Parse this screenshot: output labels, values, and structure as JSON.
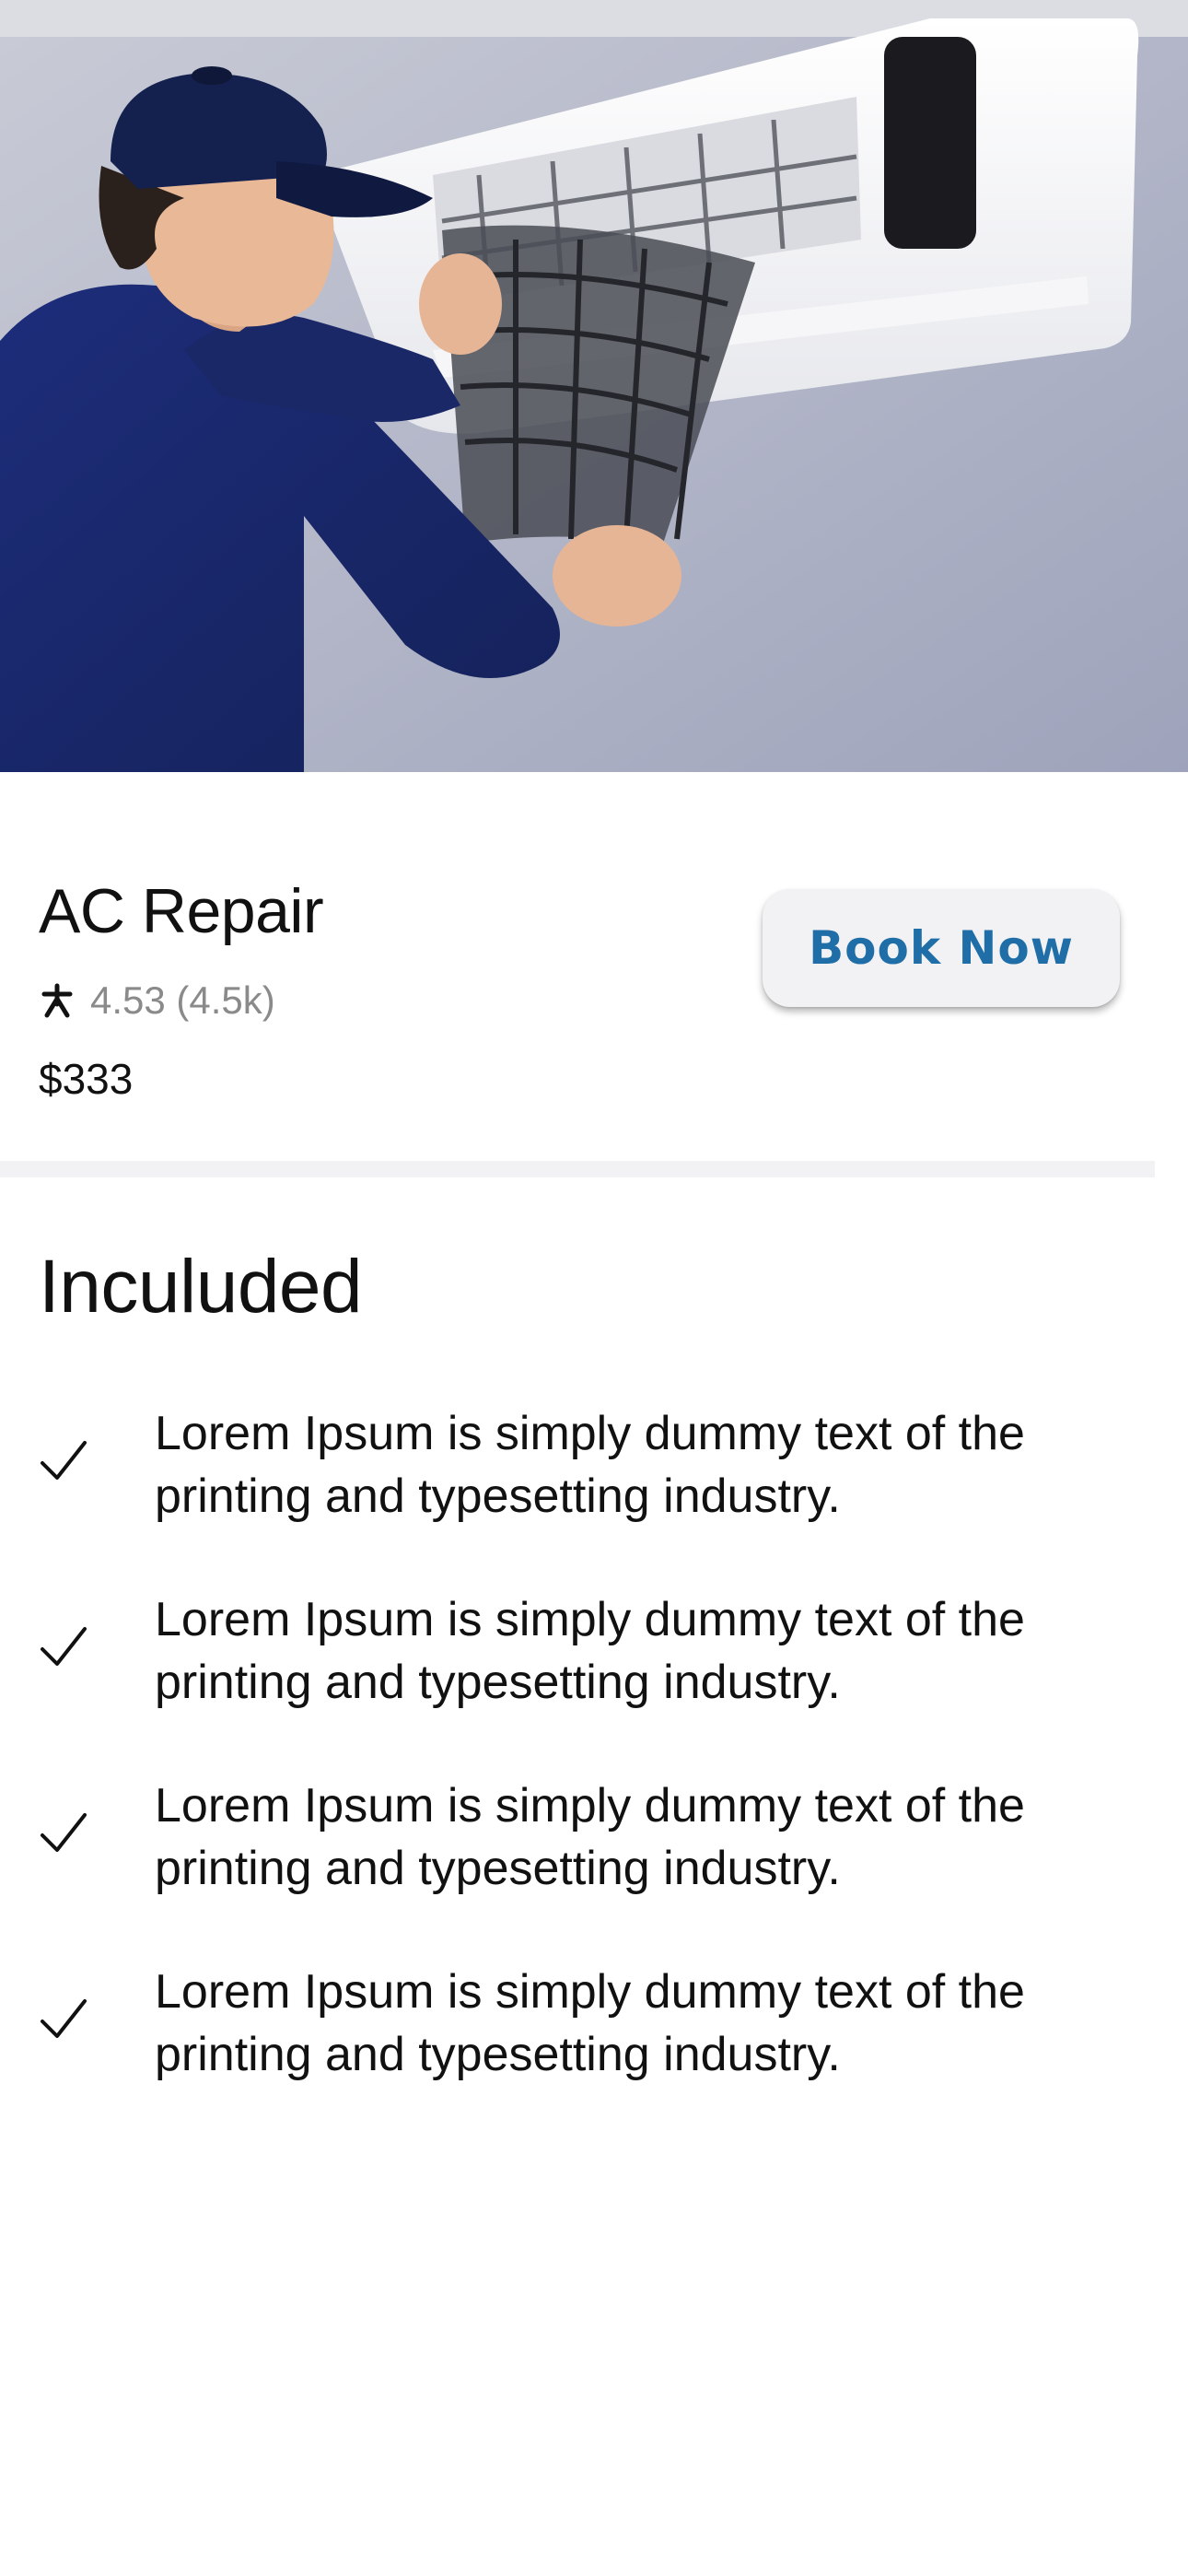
{
  "service": {
    "title": "AC Repair",
    "rating": "4.53 (4.5k)",
    "price": "$333",
    "book_label": "Book Now",
    "star_icon": "star-icon"
  },
  "included": {
    "heading": "Inculuded",
    "items": [
      {
        "text": "Lorem Ipsum is simply dummy text of the printing and typesetting industry.",
        "icon": "checkmark-icon"
      },
      {
        "text": "Lorem Ipsum is simply dummy text of the printing and typesetting industry.",
        "icon": "checkmark-icon"
      },
      {
        "text": "Lorem Ipsum is simply dummy text of the printing and typesetting industry.",
        "icon": "checkmark-icon"
      },
      {
        "text": "Lorem Ipsum is simply dummy text of the printing and typesetting industry.",
        "icon": "checkmark-icon"
      }
    ]
  },
  "colors": {
    "accent": "#1f6ea7",
    "button_bg": "#f2f2f4",
    "divider": "#f2f2f4",
    "muted_text": "#8a8a8a"
  }
}
